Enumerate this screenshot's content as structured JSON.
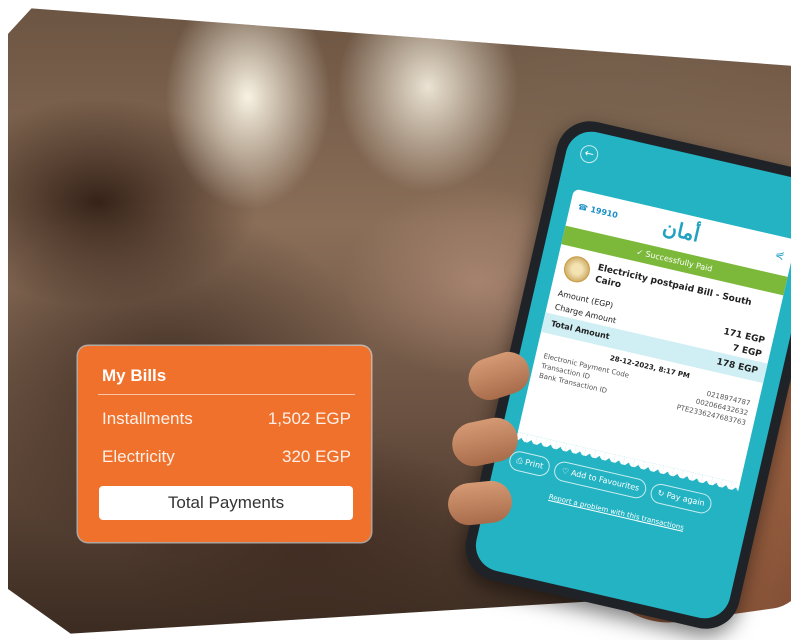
{
  "bills_card": {
    "title": "My Bills",
    "items": [
      {
        "label": "Installments",
        "amount": "1,502 EGP"
      },
      {
        "label": "Electricity",
        "amount": "320 EGP"
      }
    ],
    "total_button": "Total Payments"
  },
  "phone": {
    "hotline": "19910",
    "brand": "أمان",
    "status": "Successfully Paid",
    "biller": "Electricity postpaid Bill - South Cairo",
    "rows": [
      {
        "label": "Amount (EGP)",
        "value": "171 EGP"
      },
      {
        "label": "Charge Amount",
        "value": "7 EGP"
      }
    ],
    "total": {
      "label": "Total Amount",
      "value": "178 EGP"
    },
    "datetime": "28-12-2023, 8:17 PM",
    "meta": [
      {
        "label": "Electronic Payment Code",
        "value": "0218974787"
      },
      {
        "label": "Transaction ID",
        "value": "002066432632"
      },
      {
        "label": "Bank Transaction ID",
        "value": "PTE2336247683763"
      }
    ],
    "actions": {
      "print": "Print",
      "favourites": "Add to Favourites",
      "pay_again": "Pay again"
    },
    "report_link": "Report a problem with this transactions"
  },
  "colors": {
    "card": "#f0712b",
    "screen": "#23b3c2",
    "success": "#7cb83a",
    "brand": "#22a2c1"
  },
  "icons": [
    "phone-icon",
    "share-icon",
    "check-circle-icon",
    "back-arrow-icon",
    "print-icon",
    "heart-icon",
    "refresh-icon"
  ]
}
